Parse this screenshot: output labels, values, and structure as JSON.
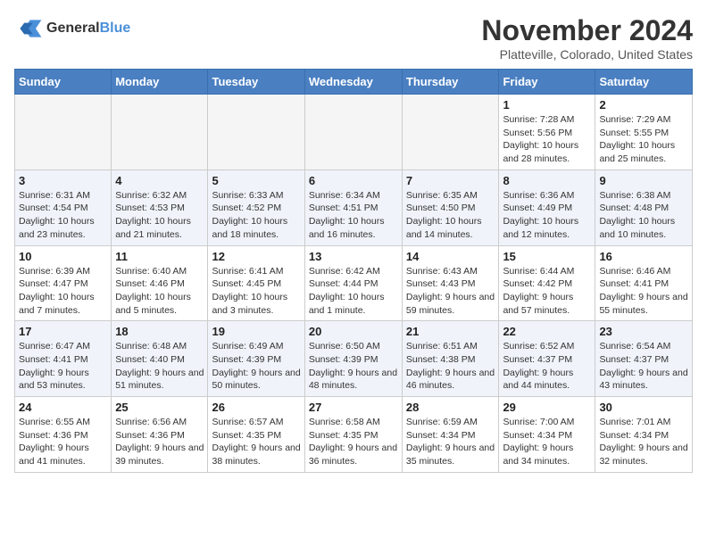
{
  "logo": {
    "line1": "General",
    "line2": "Blue"
  },
  "title": "November 2024",
  "location": "Platteville, Colorado, United States",
  "days_of_week": [
    "Sunday",
    "Monday",
    "Tuesday",
    "Wednesday",
    "Thursday",
    "Friday",
    "Saturday"
  ],
  "weeks": [
    [
      {
        "day": "",
        "info": ""
      },
      {
        "day": "",
        "info": ""
      },
      {
        "day": "",
        "info": ""
      },
      {
        "day": "",
        "info": ""
      },
      {
        "day": "",
        "info": ""
      },
      {
        "day": "1",
        "info": "Sunrise: 7:28 AM\nSunset: 5:56 PM\nDaylight: 10 hours and 28 minutes."
      },
      {
        "day": "2",
        "info": "Sunrise: 7:29 AM\nSunset: 5:55 PM\nDaylight: 10 hours and 25 minutes."
      }
    ],
    [
      {
        "day": "3",
        "info": "Sunrise: 6:31 AM\nSunset: 4:54 PM\nDaylight: 10 hours and 23 minutes."
      },
      {
        "day": "4",
        "info": "Sunrise: 6:32 AM\nSunset: 4:53 PM\nDaylight: 10 hours and 21 minutes."
      },
      {
        "day": "5",
        "info": "Sunrise: 6:33 AM\nSunset: 4:52 PM\nDaylight: 10 hours and 18 minutes."
      },
      {
        "day": "6",
        "info": "Sunrise: 6:34 AM\nSunset: 4:51 PM\nDaylight: 10 hours and 16 minutes."
      },
      {
        "day": "7",
        "info": "Sunrise: 6:35 AM\nSunset: 4:50 PM\nDaylight: 10 hours and 14 minutes."
      },
      {
        "day": "8",
        "info": "Sunrise: 6:36 AM\nSunset: 4:49 PM\nDaylight: 10 hours and 12 minutes."
      },
      {
        "day": "9",
        "info": "Sunrise: 6:38 AM\nSunset: 4:48 PM\nDaylight: 10 hours and 10 minutes."
      }
    ],
    [
      {
        "day": "10",
        "info": "Sunrise: 6:39 AM\nSunset: 4:47 PM\nDaylight: 10 hours and 7 minutes."
      },
      {
        "day": "11",
        "info": "Sunrise: 6:40 AM\nSunset: 4:46 PM\nDaylight: 10 hours and 5 minutes."
      },
      {
        "day": "12",
        "info": "Sunrise: 6:41 AM\nSunset: 4:45 PM\nDaylight: 10 hours and 3 minutes."
      },
      {
        "day": "13",
        "info": "Sunrise: 6:42 AM\nSunset: 4:44 PM\nDaylight: 10 hours and 1 minute."
      },
      {
        "day": "14",
        "info": "Sunrise: 6:43 AM\nSunset: 4:43 PM\nDaylight: 9 hours and 59 minutes."
      },
      {
        "day": "15",
        "info": "Sunrise: 6:44 AM\nSunset: 4:42 PM\nDaylight: 9 hours and 57 minutes."
      },
      {
        "day": "16",
        "info": "Sunrise: 6:46 AM\nSunset: 4:41 PM\nDaylight: 9 hours and 55 minutes."
      }
    ],
    [
      {
        "day": "17",
        "info": "Sunrise: 6:47 AM\nSunset: 4:41 PM\nDaylight: 9 hours and 53 minutes."
      },
      {
        "day": "18",
        "info": "Sunrise: 6:48 AM\nSunset: 4:40 PM\nDaylight: 9 hours and 51 minutes."
      },
      {
        "day": "19",
        "info": "Sunrise: 6:49 AM\nSunset: 4:39 PM\nDaylight: 9 hours and 50 minutes."
      },
      {
        "day": "20",
        "info": "Sunrise: 6:50 AM\nSunset: 4:39 PM\nDaylight: 9 hours and 48 minutes."
      },
      {
        "day": "21",
        "info": "Sunrise: 6:51 AM\nSunset: 4:38 PM\nDaylight: 9 hours and 46 minutes."
      },
      {
        "day": "22",
        "info": "Sunrise: 6:52 AM\nSunset: 4:37 PM\nDaylight: 9 hours and 44 minutes."
      },
      {
        "day": "23",
        "info": "Sunrise: 6:54 AM\nSunset: 4:37 PM\nDaylight: 9 hours and 43 minutes."
      }
    ],
    [
      {
        "day": "24",
        "info": "Sunrise: 6:55 AM\nSunset: 4:36 PM\nDaylight: 9 hours and 41 minutes."
      },
      {
        "day": "25",
        "info": "Sunrise: 6:56 AM\nSunset: 4:36 PM\nDaylight: 9 hours and 39 minutes."
      },
      {
        "day": "26",
        "info": "Sunrise: 6:57 AM\nSunset: 4:35 PM\nDaylight: 9 hours and 38 minutes."
      },
      {
        "day": "27",
        "info": "Sunrise: 6:58 AM\nSunset: 4:35 PM\nDaylight: 9 hours and 36 minutes."
      },
      {
        "day": "28",
        "info": "Sunrise: 6:59 AM\nSunset: 4:34 PM\nDaylight: 9 hours and 35 minutes."
      },
      {
        "day": "29",
        "info": "Sunrise: 7:00 AM\nSunset: 4:34 PM\nDaylight: 9 hours and 34 minutes."
      },
      {
        "day": "30",
        "info": "Sunrise: 7:01 AM\nSunset: 4:34 PM\nDaylight: 9 hours and 32 minutes."
      }
    ]
  ]
}
